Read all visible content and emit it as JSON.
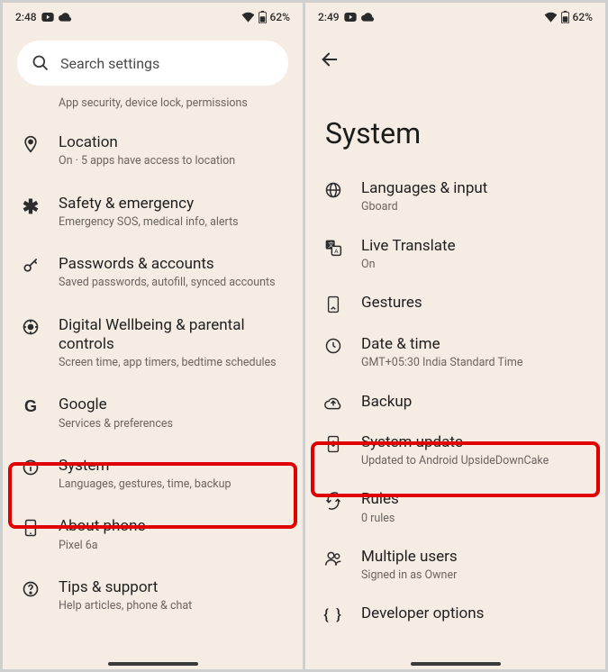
{
  "left": {
    "status": {
      "time": "2:48",
      "battery": "62%"
    },
    "search_placeholder": "Search settings",
    "truncated_prev_sub": "App security, device lock, permissions",
    "items": [
      {
        "icon": "location",
        "title": "Location",
        "sub": "On · 5 apps have access to location"
      },
      {
        "icon": "asterisk",
        "title": "Safety & emergency",
        "sub": "Emergency SOS, medical info, alerts"
      },
      {
        "icon": "key",
        "title": "Passwords & accounts",
        "sub": "Saved passwords, autofill, synced accounts"
      },
      {
        "icon": "wellbeing",
        "title": "Digital Wellbeing & parental controls",
        "sub": "Screen time, app timers, bedtime schedules"
      },
      {
        "icon": "google",
        "title": "Google",
        "sub": "Services & preferences"
      },
      {
        "icon": "info",
        "title": "System",
        "sub": "Languages, gestures, time, backup"
      },
      {
        "icon": "phone",
        "title": "About phone",
        "sub": "Pixel 6a"
      },
      {
        "icon": "help",
        "title": "Tips & support",
        "sub": "Help articles, phone & chat"
      }
    ]
  },
  "right": {
    "status": {
      "time": "2:49",
      "battery": "62%"
    },
    "page_title": "System",
    "items": [
      {
        "icon": "globe",
        "title": "Languages & input",
        "sub": "Gboard"
      },
      {
        "icon": "translate",
        "title": "Live Translate",
        "sub": "On"
      },
      {
        "icon": "gestures",
        "title": "Gestures",
        "sub": ""
      },
      {
        "icon": "clock",
        "title": "Date & time",
        "sub": "GMT+05:30 India Standard Time"
      },
      {
        "icon": "backup",
        "title": "Backup",
        "sub": ""
      },
      {
        "icon": "update",
        "title": "System update",
        "sub": "Updated to Android UpsideDownCake"
      },
      {
        "icon": "rules",
        "title": "Rules",
        "sub": "0 rules"
      },
      {
        "icon": "users",
        "title": "Multiple users",
        "sub": "Signed in as Owner"
      },
      {
        "icon": "dev",
        "title": "Developer options",
        "sub": ""
      }
    ]
  }
}
